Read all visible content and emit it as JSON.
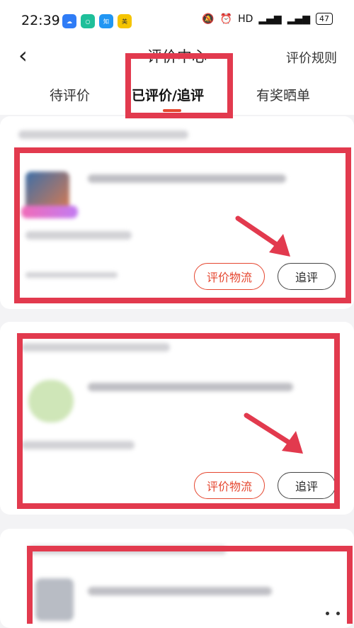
{
  "status_bar": {
    "time": "22:39",
    "icons_right": [
      "mute-icon",
      "alarm-icon"
    ],
    "network": "HD",
    "battery": "47"
  },
  "nav": {
    "back_icon": "chevron-left-icon",
    "title": "评价中心",
    "rules": "评价规则"
  },
  "tabs": [
    {
      "label": "待评价"
    },
    {
      "label": "已评价/追评"
    },
    {
      "label": "有奖晒单"
    }
  ],
  "active_tab": 1,
  "cards": [
    {
      "logistics_label": "评价物流",
      "follow_label": "追评"
    },
    {
      "logistics_label": "评价物流",
      "follow_label": "追评"
    }
  ],
  "accent_color": "#e5462f",
  "highlight_color": "#e23a4e"
}
